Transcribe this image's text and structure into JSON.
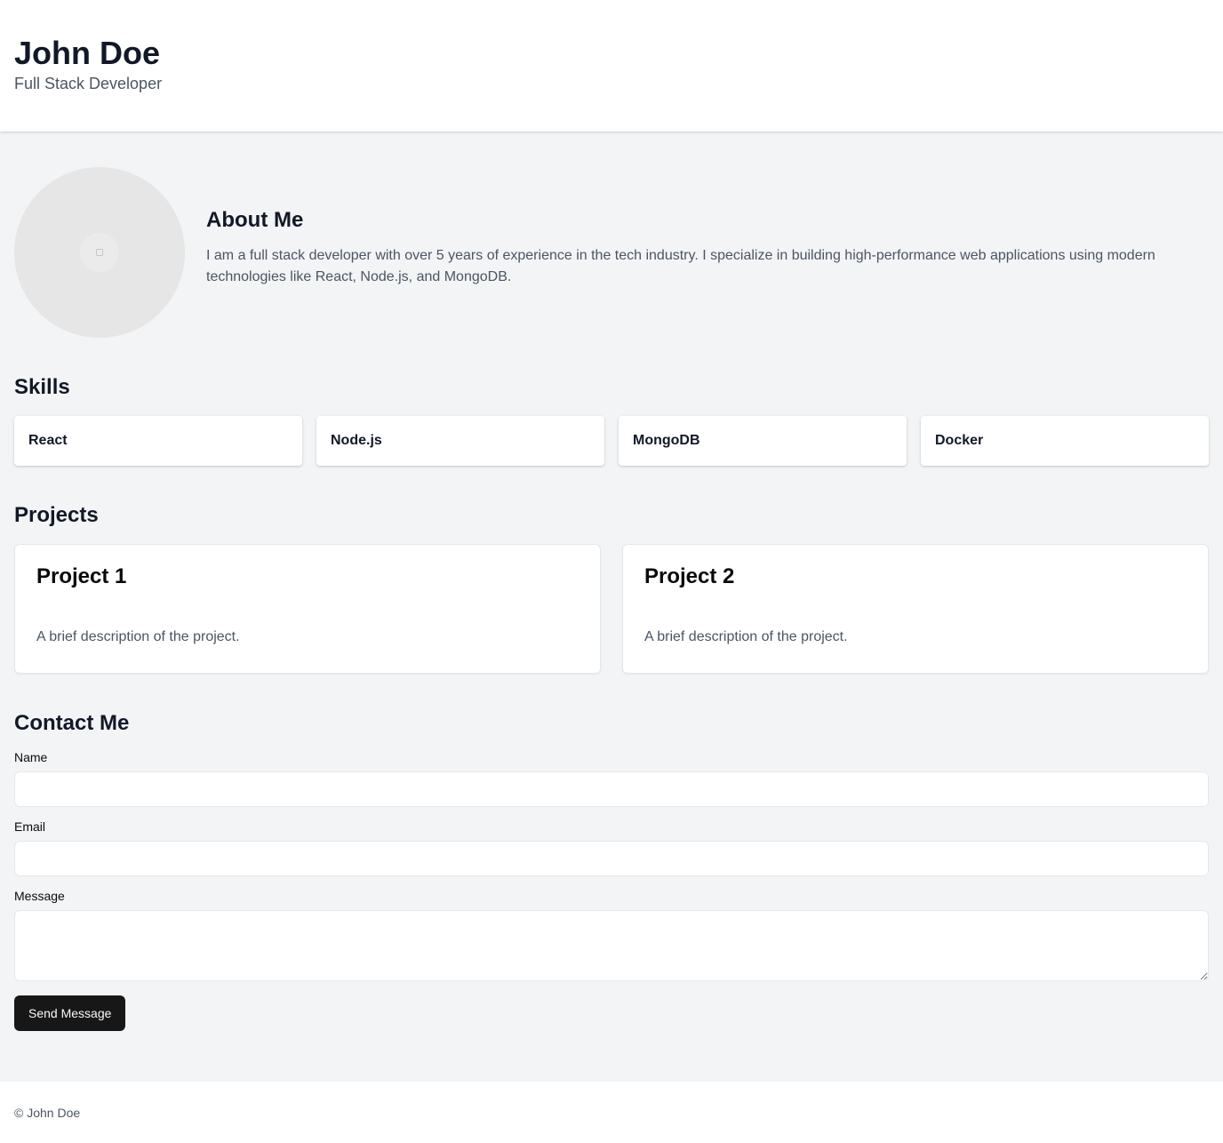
{
  "header": {
    "name": "John Doe",
    "role": "Full Stack Developer"
  },
  "about": {
    "avatar_icon": "image-placeholder-icon",
    "heading": "About Me",
    "body": "I am a full stack developer with over 5 years of experience in the tech industry. I specialize in building high-performance web applications using modern technologies like React, Node.js, and MongoDB."
  },
  "skills": {
    "heading": "Skills",
    "items": [
      "React",
      "Node.js",
      "MongoDB",
      "Docker"
    ]
  },
  "projects": {
    "heading": "Projects",
    "items": [
      {
        "title": "Project 1",
        "description": "A brief description of the project."
      },
      {
        "title": "Project 2",
        "description": "A brief description of the project."
      }
    ]
  },
  "contact": {
    "heading": "Contact Me",
    "name_label": "Name",
    "name_value": "",
    "email_label": "Email",
    "email_value": "",
    "message_label": "Message",
    "message_value": "",
    "submit_label": "Send Message"
  },
  "footer": {
    "copyright": "© John Doe"
  },
  "colors": {
    "page_bg": "#f3f4f6",
    "card_bg": "#ffffff",
    "heading": "#111827",
    "muted_text": "#4b5563",
    "button_bg": "#171717",
    "button_text": "#fafafa"
  }
}
